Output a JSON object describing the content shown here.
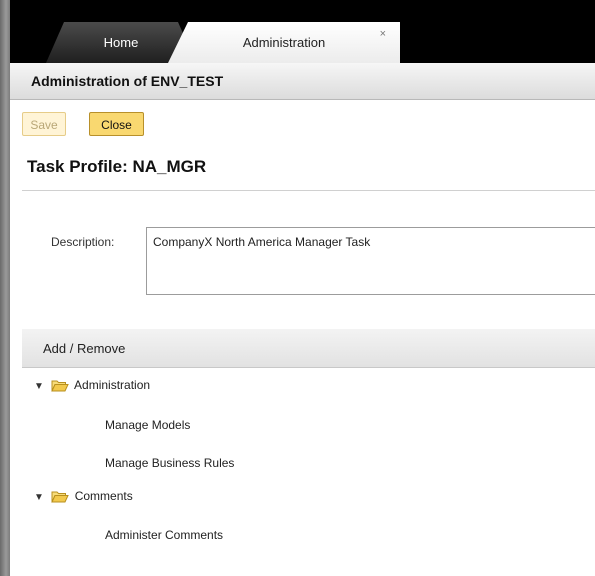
{
  "tabs": [
    {
      "label": "Home",
      "active": false
    },
    {
      "label": "Administration",
      "active": true,
      "close_glyph": "×"
    }
  ],
  "breadcrumb": {
    "title": "Administration of ENV_TEST"
  },
  "toolbar": {
    "save_label": "Save",
    "close_label": "Close"
  },
  "page": {
    "title": "Task Profile: NA_MGR"
  },
  "form": {
    "description_label": "Description:",
    "description_value": "CompanyX North America Manager Task"
  },
  "panel": {
    "header": "Add / Remove",
    "tree": [
      {
        "label": "Administration",
        "expanded": true,
        "icon": "folder-open-icon",
        "children": [
          "Manage Models",
          "Manage Business Rules"
        ]
      },
      {
        "label": "Comments",
        "expanded": true,
        "icon": "folder-open-icon",
        "children": [
          "Administer Comments"
        ]
      }
    ]
  },
  "colors": {
    "accent_button": "#f9d870",
    "folder": "#f2c94c"
  }
}
